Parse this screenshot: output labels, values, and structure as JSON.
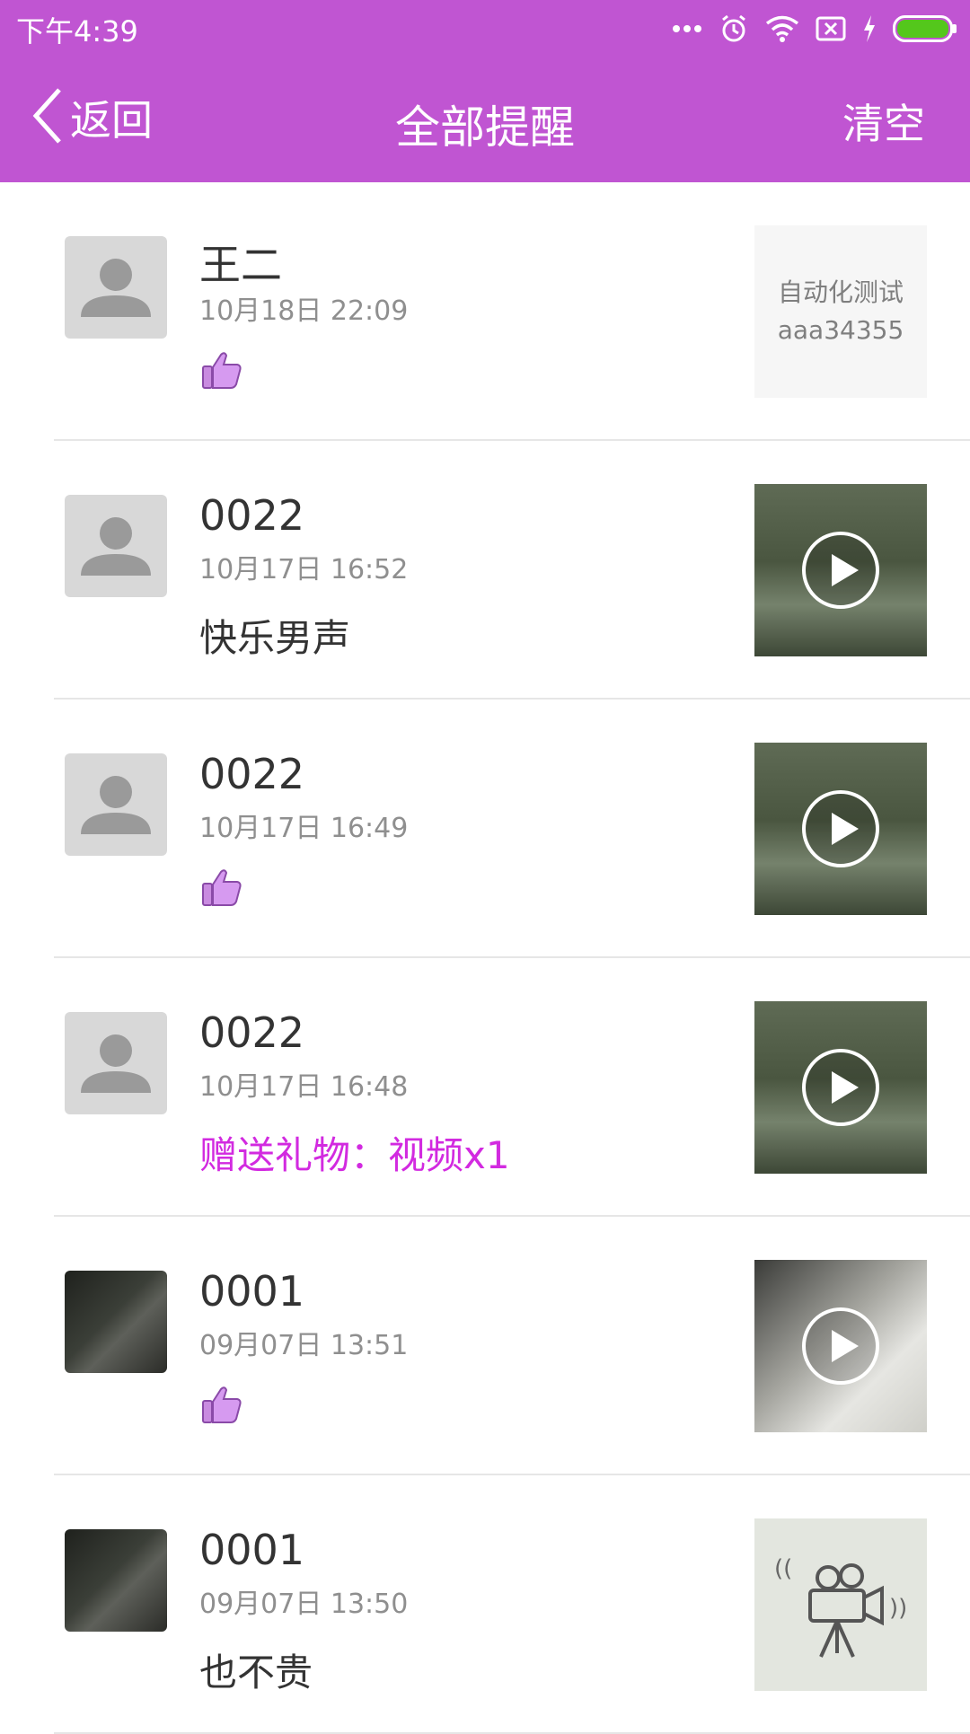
{
  "status_bar": {
    "time": "下午4:39"
  },
  "header": {
    "back_label": "返回",
    "title": "全部提醒",
    "clear_label": "清空"
  },
  "colors": {
    "accent": "#c055d2",
    "gift_text": "#d22ae0",
    "battery": "#54c71c"
  },
  "items": [
    {
      "name": "王二",
      "time": "10月18日 22:09",
      "type": "like",
      "thumb_type": "text",
      "thumb_text_1": "自动化测试",
      "thumb_text_2": "aaa34355",
      "avatar": "default"
    },
    {
      "name": "0022",
      "time": "10月17日 16:52",
      "type": "text",
      "content": "快乐男声",
      "thumb_type": "video",
      "avatar": "default"
    },
    {
      "name": "0022",
      "time": "10月17日 16:49",
      "type": "like",
      "thumb_type": "video",
      "avatar": "default"
    },
    {
      "name": "0022",
      "time": "10月17日 16:48",
      "type": "gift",
      "content": "赠送礼物：视频x1",
      "thumb_type": "video",
      "avatar": "default"
    },
    {
      "name": "0001",
      "time": "09月07日 13:51",
      "type": "like",
      "thumb_type": "video",
      "avatar": "photo"
    },
    {
      "name": "0001",
      "time": "09月07日 13:50",
      "type": "text",
      "content": "也不贵",
      "thumb_type": "placeholder",
      "avatar": "photo"
    }
  ]
}
